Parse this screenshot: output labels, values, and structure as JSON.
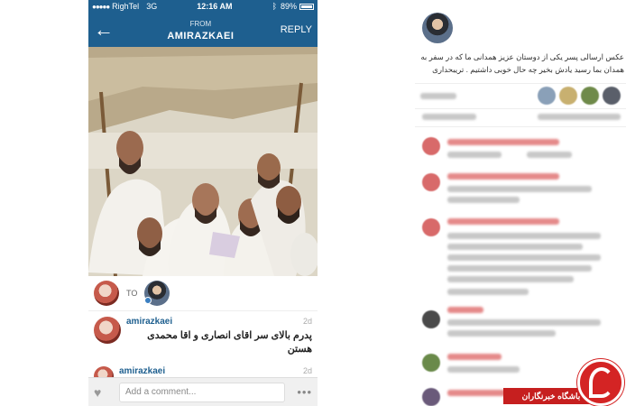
{
  "status_bar": {
    "carrier": "RighTel",
    "network": "3G",
    "time": "12:16 AM",
    "battery": "89%"
  },
  "nav": {
    "back_icon": "arrow-left-icon",
    "from_label": "FROM",
    "sender": "AMIRAZKAEI",
    "reply_label": "REPLY"
  },
  "tag_row": {
    "to_label": "TO"
  },
  "comments": [
    {
      "user": "amirazkaei",
      "age": "2d",
      "text": "پدرم بالای سر اقای انصاری و اقا محمدی هستن"
    },
    {
      "user": "amirazkaei",
      "age": "2d"
    }
  ],
  "input": {
    "placeholder": "Add a comment...",
    "more_icon": "ellipsis-icon"
  },
  "right_panel": {
    "caption": "عکس ارسالی پسر یکی از دوستان عزیز همدانی ما که در سفر به همدان بما رسید یادش بخیر چه حال خوبی داشتیم . تریبحداری"
  },
  "badge": {
    "label": "باشگاه خبرنگاران"
  },
  "colors": {
    "nav_blue": "#1e5f8f",
    "badge_red": "#c61f1f"
  }
}
